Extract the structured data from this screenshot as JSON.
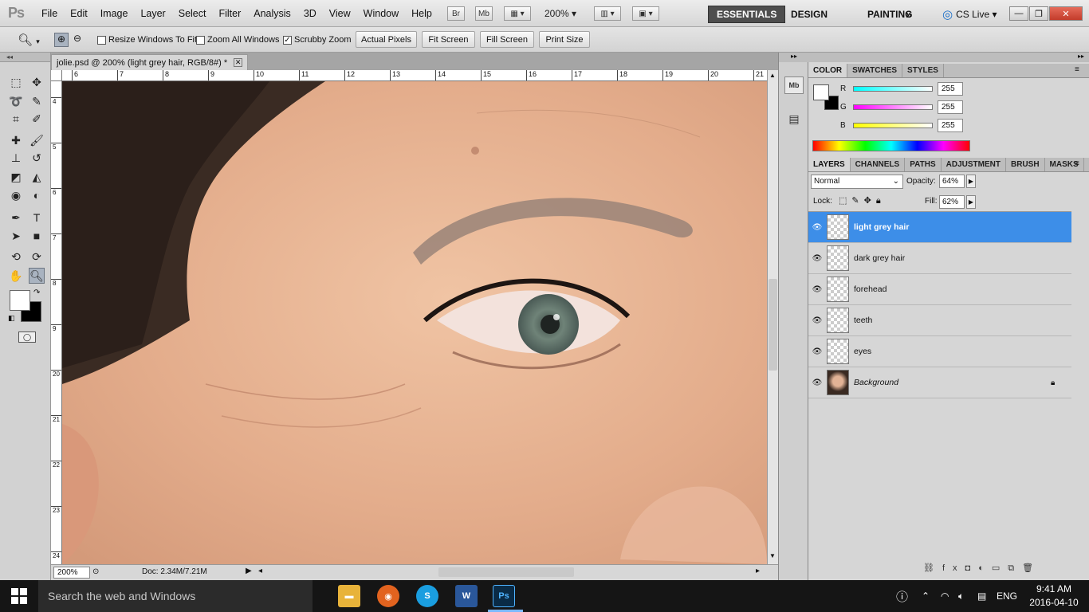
{
  "app": {
    "logo": "Ps",
    "menu": [
      "File",
      "Edit",
      "Image",
      "Layer",
      "Select",
      "Filter",
      "Analysis",
      "3D",
      "View",
      "Window",
      "Help"
    ],
    "bridge": "Br",
    "minibridge": "Mb",
    "zoom": "200%",
    "workspaces": [
      "ESSENTIALS",
      "DESIGN",
      "PAINTING"
    ],
    "more": "»",
    "cslive": "CS Live"
  },
  "options": {
    "resize_windows": "Resize Windows To Fit",
    "zoom_all": "Zoom All Windows",
    "scrubby": "Scrubby Zoom",
    "actual_pixels": "Actual Pixels",
    "fit_screen": "Fit Screen",
    "fill_screen": "Fill Screen",
    "print_size": "Print Size"
  },
  "document": {
    "tab_title": "jolie.psd @ 200% (light grey hair, RGB/8#) *",
    "ruler_top": [
      "6",
      "7",
      "8",
      "9",
      "10",
      "11",
      "12",
      "13",
      "14",
      "15",
      "16",
      "17",
      "18",
      "19",
      "20",
      "21"
    ],
    "ruler_left": [
      "4",
      "5",
      "6",
      "7",
      "8",
      "9",
      "20",
      "21",
      "22",
      "23",
      "24"
    ],
    "zoom": "200%",
    "doc_info": "Doc: 2.34M/7.21M"
  },
  "color_panel": {
    "tabs": [
      "COLOR",
      "SWATCHES",
      "STYLES"
    ],
    "r_label": "R",
    "g_label": "G",
    "b_label": "B",
    "r": "255",
    "g": "255",
    "b": "255"
  },
  "layers_panel": {
    "tabs": [
      "LAYERS",
      "CHANNELS",
      "PATHS",
      "ADJUSTMENT",
      "BRUSH",
      "MASKS"
    ],
    "blend_mode": "Normal",
    "opacity_label": "Opacity:",
    "opacity": "64%",
    "lock_label": "Lock:",
    "fill_label": "Fill:",
    "fill": "62%",
    "layers": [
      {
        "name": "light grey hair",
        "selected": true
      },
      {
        "name": "dark grey hair",
        "selected": false
      },
      {
        "name": "forehead",
        "selected": false
      },
      {
        "name": "teeth",
        "selected": false
      },
      {
        "name": "eyes",
        "selected": false
      },
      {
        "name": "Background",
        "selected": false
      }
    ]
  },
  "taskbar": {
    "search_placeholder": "Search the web and Windows",
    "time": "9:41 AM",
    "date": "2016-04-10",
    "lang": "ENG"
  }
}
